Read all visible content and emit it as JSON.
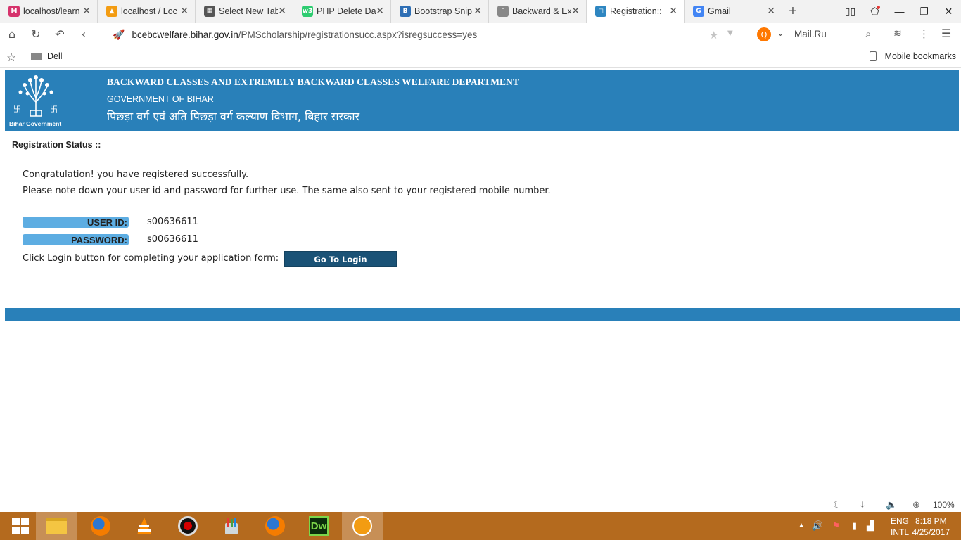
{
  "browser": {
    "tabs": [
      {
        "title": "localhost/learn",
        "favicon_color": "#d6336c",
        "favicon_glyph": "M"
      },
      {
        "title": "localhost / Loc",
        "favicon_color": "#f39c12",
        "favicon_glyph": "▲"
      },
      {
        "title": "Select New Tab",
        "favicon_color": "#555555",
        "favicon_glyph": "▦"
      },
      {
        "title": "PHP Delete Dat",
        "favicon_color": "#2ecc71",
        "favicon_glyph": "w3"
      },
      {
        "title": "Bootstrap Snip",
        "favicon_color": "#2e6fb5",
        "favicon_glyph": "B"
      },
      {
        "title": "Backward & Ext",
        "favicon_color": "#888888",
        "favicon_glyph": "▯"
      },
      {
        "title": "Registration::",
        "favicon_color": "#2e86c1",
        "favicon_glyph": "◻"
      },
      {
        "title": "Gmail",
        "favicon_color": "#4285f4",
        "favicon_glyph": "G"
      }
    ],
    "active_tab_index": 6,
    "new_tab_icon": "plus-icon",
    "url_host": "bcebcwelfare.bihar.gov.in",
    "url_path": "/PMScholarship/registrationsucc.aspx?isregsuccess=yes",
    "search_engine_label": "Mail.Ru",
    "bookmarks": {
      "folder": "Dell",
      "mobile": "Mobile bookmarks"
    }
  },
  "site": {
    "dept_name_en": "BACKWARD CLASSES AND EXTREMELY BACKWARD CLASSES WELFARE DEPARTMENT",
    "gov_name": "GOVERNMENT OF BIHAR",
    "dept_name_hi": "पिछड़ा वर्ग एवं अति पिछड़ा वर्ग कल्याण विभाग, बिहार सरकार",
    "emblem_caption": "Bihar Government",
    "header_color": "#2980b9"
  },
  "registration": {
    "section_title": "Registration Status ::",
    "message_1": "Congratulation! you have registered successfully.",
    "message_2": "Please note down your user id and password for further use. The same also sent to your registered mobile number.",
    "user_id_label": "USER ID:",
    "user_id_value": "s00636611",
    "password_label": "PASSWORD:",
    "password_value": "s00636611",
    "login_prompt": "Click Login button for completing your application form:",
    "login_button": "Go To Login"
  },
  "statusbar": {
    "zoom": "100%"
  },
  "taskbar": {
    "apps": [
      "start-button",
      "file-explorer-icon",
      "firefox-icon",
      "vlc-icon",
      "recorder-icon",
      "paint-icon",
      "firefox-icon",
      "dreamweaver-icon",
      "uc-browser-icon"
    ],
    "lang_line1": "ENG",
    "lang_line2": "INTL",
    "time": "8:18 PM",
    "date": "4/25/2017"
  }
}
